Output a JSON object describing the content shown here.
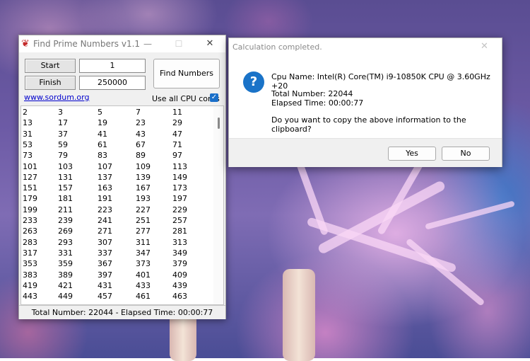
{
  "app": {
    "title": "Find Prime Numbers v1.1",
    "icon": "logo-icon",
    "controls": {
      "minimize": "—",
      "maximize": "☐",
      "close": "✕"
    },
    "start_label": "Start",
    "start_value": "1",
    "finish_label": "Finish",
    "finish_value": "250000",
    "find_button": "Find Numbers",
    "link": "www.sordum.org",
    "cpu_label": "Use all CPU cores",
    "cpu_checked": true,
    "primes": [
      [
        "2",
        "3",
        "5",
        "7",
        "11"
      ],
      [
        "13",
        "17",
        "19",
        "23",
        "29"
      ],
      [
        "31",
        "37",
        "41",
        "43",
        "47"
      ],
      [
        "53",
        "59",
        "61",
        "67",
        "71"
      ],
      [
        "73",
        "79",
        "83",
        "89",
        "97"
      ],
      [
        "101",
        "103",
        "107",
        "109",
        "113"
      ],
      [
        "127",
        "131",
        "137",
        "139",
        "149"
      ],
      [
        "151",
        "157",
        "163",
        "167",
        "173"
      ],
      [
        "179",
        "181",
        "191",
        "193",
        "197"
      ],
      [
        "199",
        "211",
        "223",
        "227",
        "229"
      ],
      [
        "233",
        "239",
        "241",
        "251",
        "257"
      ],
      [
        "263",
        "269",
        "271",
        "277",
        "281"
      ],
      [
        "283",
        "293",
        "307",
        "311",
        "313"
      ],
      [
        "317",
        "331",
        "337",
        "347",
        "349"
      ],
      [
        "353",
        "359",
        "367",
        "373",
        "379"
      ],
      [
        "383",
        "389",
        "397",
        "401",
        "409"
      ],
      [
        "419",
        "421",
        "431",
        "433",
        "439"
      ],
      [
        "443",
        "449",
        "457",
        "461",
        "463"
      ]
    ],
    "status": "Total Number: 22044  -  Elapsed Time: 00:00:77"
  },
  "dialog": {
    "title": "Calculation completed.",
    "icon": "question-icon",
    "cpu_line": "Cpu Name: Intel(R) Core(TM) i9-10850K CPU @ 3.60GHz +20",
    "total_line": "Total Number: 22044",
    "elapsed_line": "Elapsed Time: 00:00:77",
    "question": "Do you want to copy the above information to the clipboard?",
    "yes_label": "Yes",
    "no_label": "No"
  }
}
